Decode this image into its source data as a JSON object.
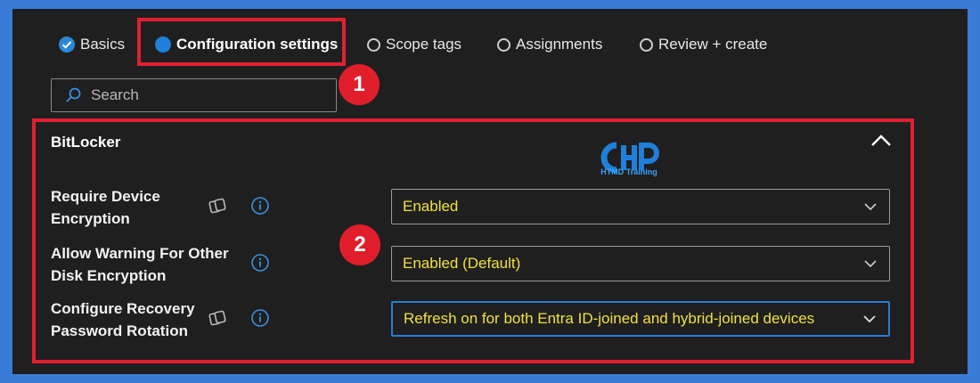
{
  "steps": [
    {
      "label": "Basics",
      "state": "completed",
      "icon": "checkmark-circle-icon"
    },
    {
      "label": "Configuration settings",
      "state": "current",
      "icon": "filled-circle-icon"
    },
    {
      "label": "Scope tags",
      "state": "pending",
      "icon": "empty-circle-icon"
    },
    {
      "label": "Assignments",
      "state": "pending",
      "icon": "empty-circle-icon"
    },
    {
      "label": "Review + create",
      "state": "pending",
      "icon": "empty-circle-icon"
    }
  ],
  "search": {
    "placeholder": "Search",
    "value": ""
  },
  "annotations": [
    "1",
    "2"
  ],
  "section": {
    "title": "BitLocker",
    "expanded": true
  },
  "logo": {
    "text": "HTMD Training"
  },
  "settings": [
    {
      "label": "Require Device Encryption",
      "value": "Enabled",
      "has_copy_icon": true
    },
    {
      "label": "Allow Warning For Other Disk Encryption",
      "value": "Enabled (Default)",
      "has_copy_icon": false
    },
    {
      "label": "Configure Recovery Password Rotation",
      "value": "Refresh on for both Entra ID-joined and hybrid-joined devices",
      "has_copy_icon": true
    }
  ],
  "colors": {
    "accent": "#1f7fd9",
    "annotation": "#e0202f",
    "value_text": "#f0e040",
    "background": "#1f1f1f"
  }
}
